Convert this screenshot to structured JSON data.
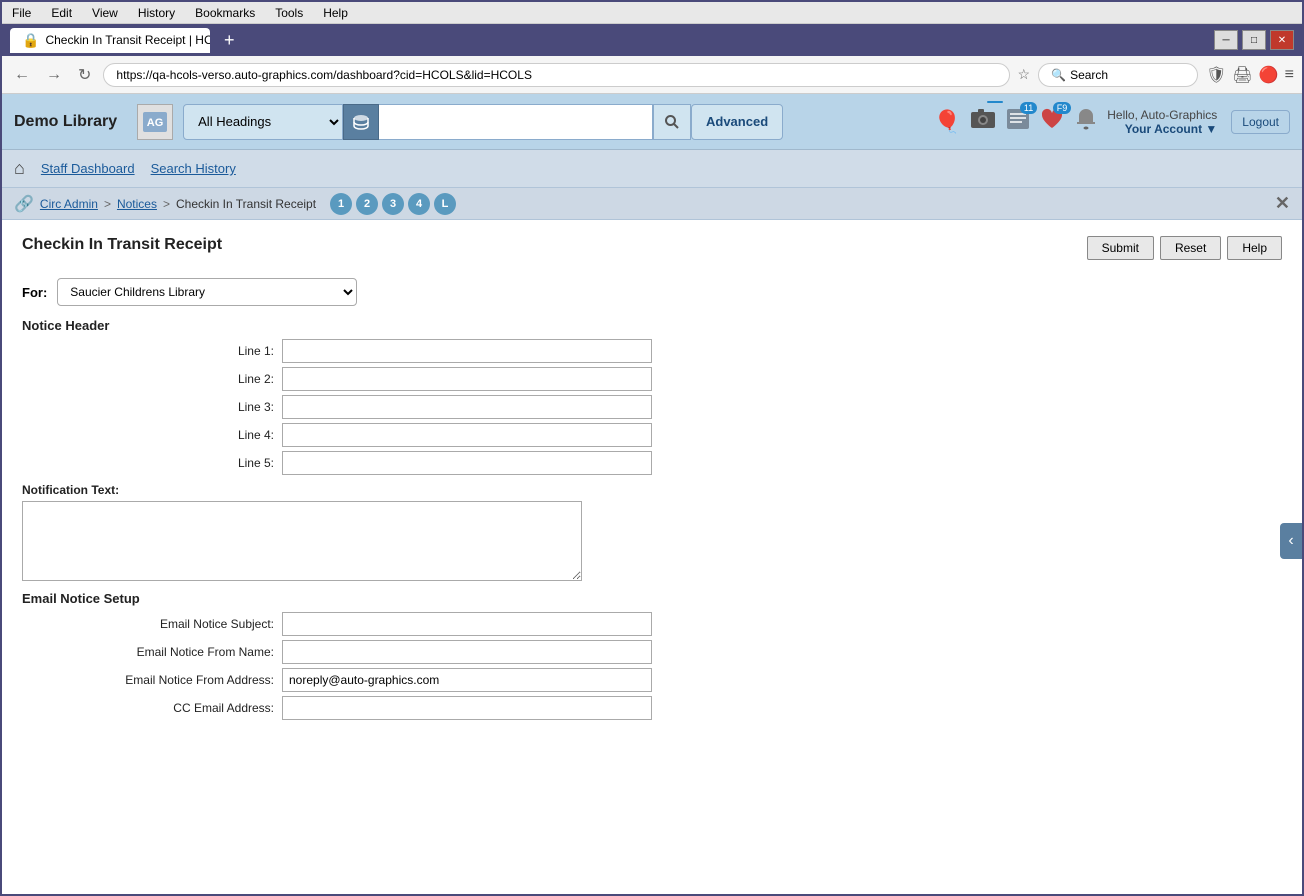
{
  "browser": {
    "tab_title": "Checkin In Transit Receipt | HCO",
    "url": "https://qa-hcols-verso.auto-graphics.com/dashboard?cid=HCOLS&lid=HCOLS",
    "search_placeholder": "Search"
  },
  "menu": {
    "items": [
      "File",
      "Edit",
      "View",
      "History",
      "Bookmarks",
      "Tools",
      "Help"
    ]
  },
  "header": {
    "library_name": "Demo Library",
    "search_heading_default": "All Headings",
    "advanced_label": "Advanced",
    "search_placeholder": "",
    "badge_notifications": "11",
    "badge_f9": "F9",
    "hello_text": "Hello, Auto-Graphics",
    "account_label": "Your Account",
    "logout_label": "Logout"
  },
  "nav": {
    "staff_dashboard": "Staff Dashboard",
    "search_history": "Search History"
  },
  "breadcrumb": {
    "circ_admin": "Circ Admin",
    "notices": "Notices",
    "current": "Checkin In Transit Receipt",
    "steps": [
      "1",
      "2",
      "3",
      "4",
      "L"
    ]
  },
  "form": {
    "title": "Checkin In Transit Receipt",
    "submit_label": "Submit",
    "reset_label": "Reset",
    "help_label": "Help",
    "for_label": "For:",
    "for_value": "Saucier Childrens Library",
    "for_options": [
      "Saucier Childrens Library"
    ],
    "notice_header_label": "Notice Header",
    "line1_label": "Line 1:",
    "line2_label": "Line 2:",
    "line3_label": "Line 3:",
    "line4_label": "Line 4:",
    "line5_label": "Line 5:",
    "notification_text_label": "Notification Text:",
    "email_section_label": "Email Notice Setup",
    "email_subject_label": "Email Notice Subject:",
    "email_from_name_label": "Email Notice From Name:",
    "email_from_address_label": "Email Notice From Address:",
    "cc_email_label": "CC Email Address:",
    "email_from_address_value": "noreply@auto-graphics.com",
    "line1_value": "",
    "line2_value": "",
    "line3_value": "",
    "line4_value": "",
    "line5_value": "",
    "notification_text_value": "",
    "email_subject_value": "",
    "email_from_name_value": "",
    "cc_email_value": ""
  }
}
